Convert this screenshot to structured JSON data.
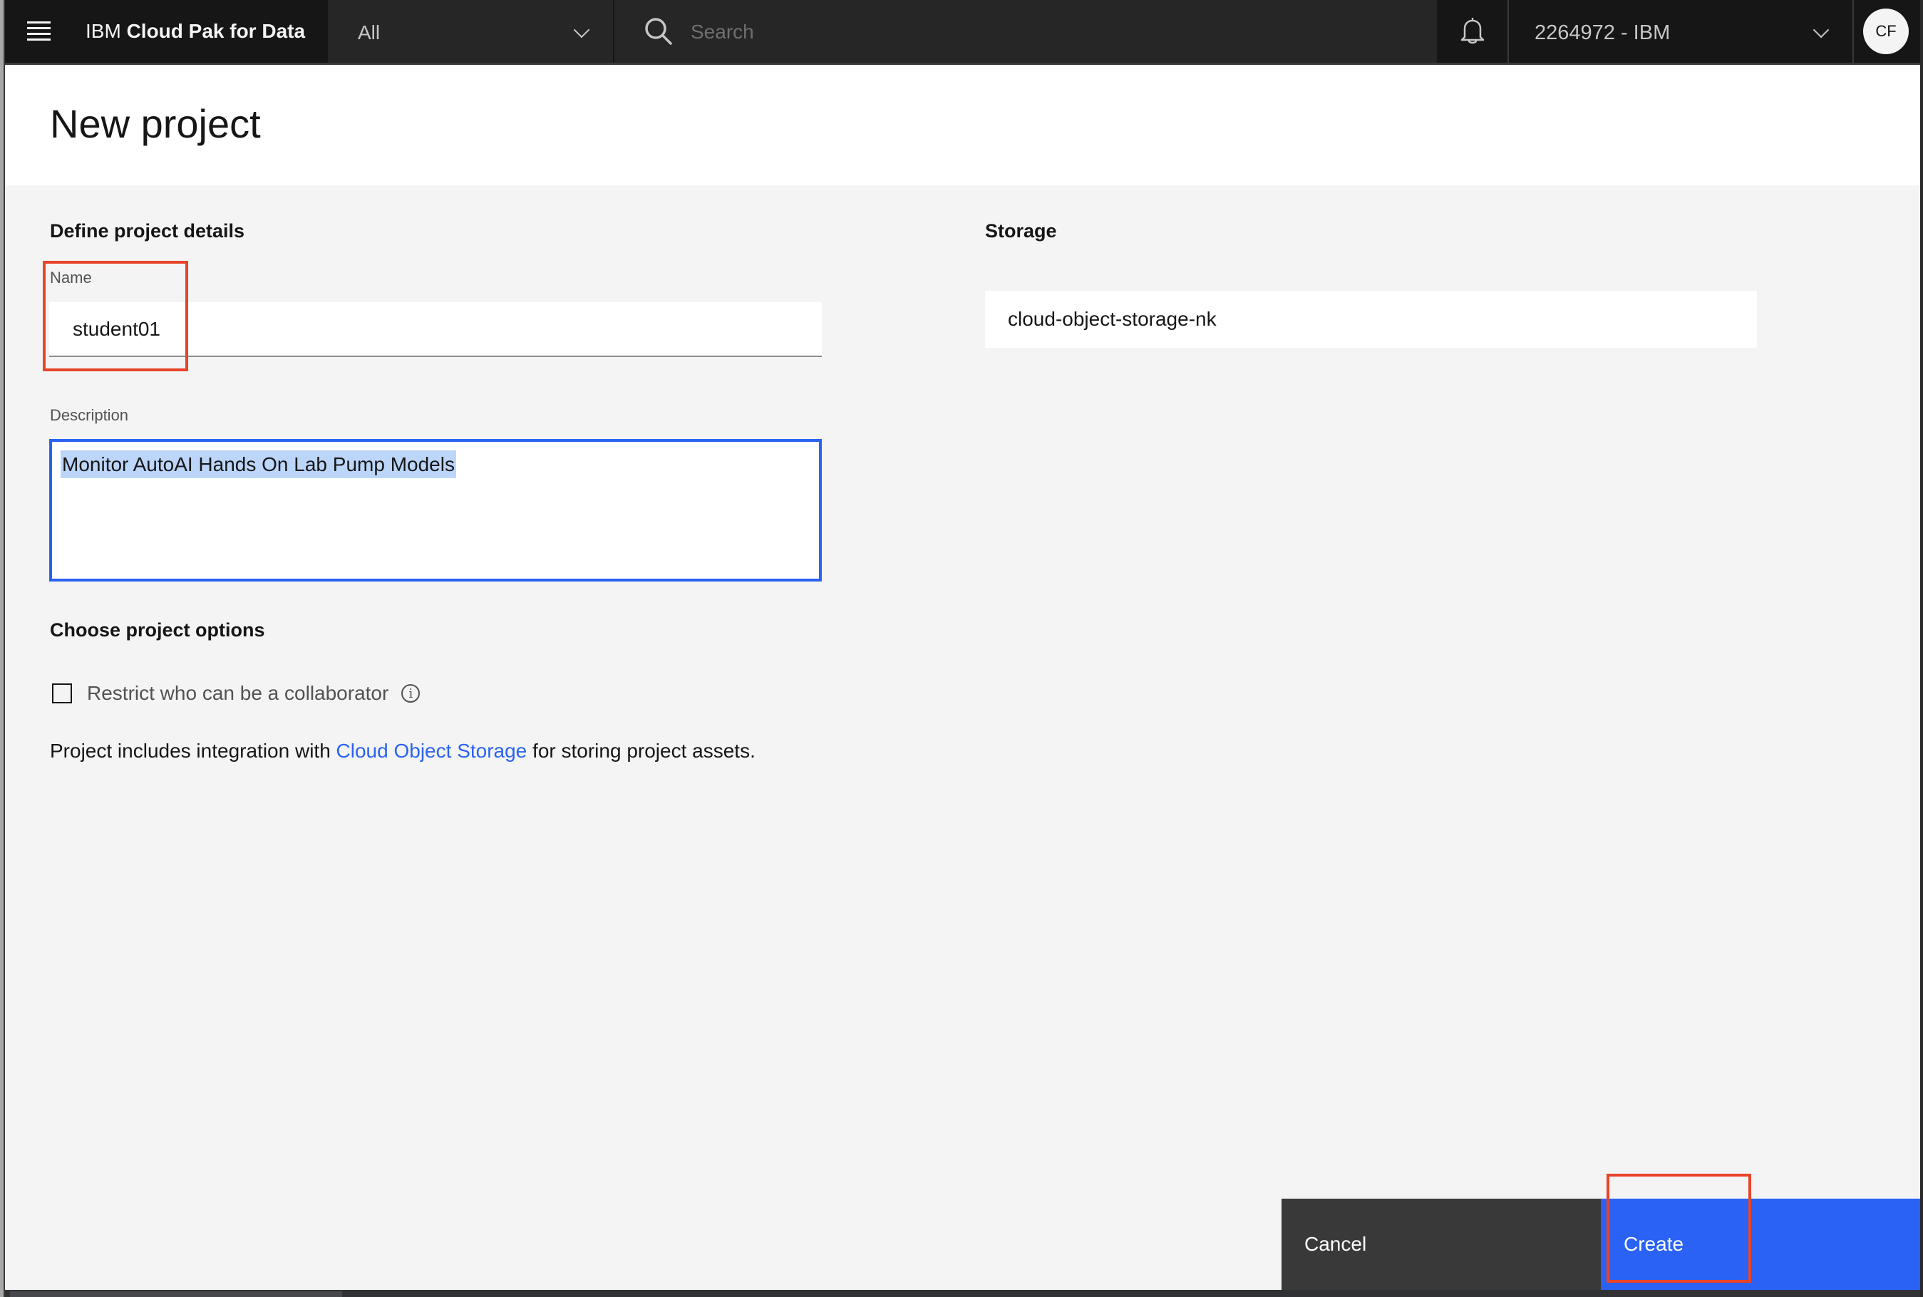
{
  "header": {
    "brand_prefix": "IBM",
    "brand_name": "Cloud Pak for Data",
    "scope_selected": "All",
    "search_placeholder": "Search",
    "account": "2264972 - IBM",
    "avatar_initials": "CF",
    "icons": [
      "hamburger-menu-icon",
      "chevron-down-icon",
      "search-icon",
      "notification-bell-icon"
    ]
  },
  "page": {
    "title": "New project"
  },
  "details": {
    "heading": "Define project details",
    "name_label": "Name",
    "name_value": "student01",
    "description_label": "Description",
    "description_value": "Monitor AutoAI Hands On Lab Pump Models"
  },
  "options": {
    "heading": "Choose project options",
    "restrict_label": "Restrict who can be a collaborator",
    "restrict_checked": false,
    "footnote_before": "Project includes integration with ",
    "footnote_link": "Cloud Object Storage",
    "footnote_after": " for storing project assets."
  },
  "storage": {
    "heading": "Storage",
    "value": "cloud-object-storage-nk"
  },
  "actions": {
    "cancel_label": "Cancel",
    "create_label": "Create"
  },
  "colors": {
    "header_bg": "#161616",
    "primary": "#2962f4",
    "secondary_button": "#393939",
    "annotation": "#e8442a",
    "link": "#2a62f2"
  }
}
